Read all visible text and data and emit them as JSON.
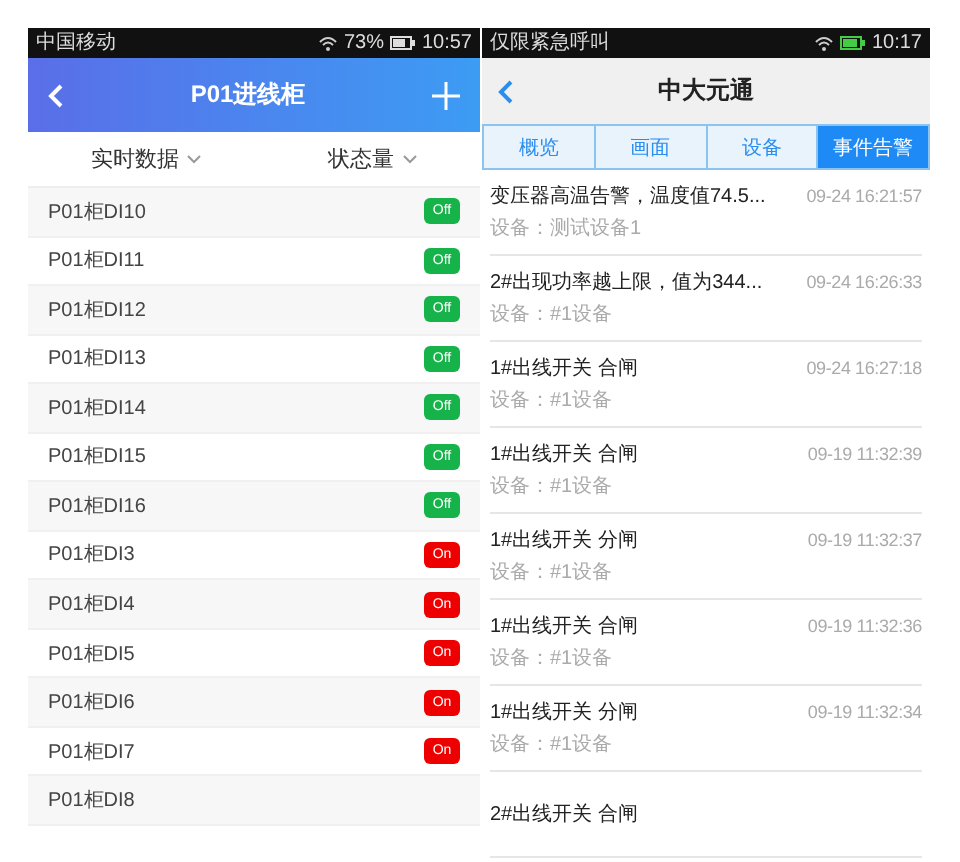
{
  "left_screen": {
    "status_bar": {
      "carrier": "中国移动",
      "battery": "73%",
      "time": "10:57"
    },
    "header": {
      "title": "P01进线柜"
    },
    "filters": [
      "实时数据",
      "状态量"
    ],
    "rows": [
      {
        "name": "P01柜DI10",
        "state": "Off",
        "on": false
      },
      {
        "name": "P01柜DI11",
        "state": "Off",
        "on": false
      },
      {
        "name": "P01柜DI12",
        "state": "Off",
        "on": false
      },
      {
        "name": "P01柜DI13",
        "state": "Off",
        "on": false
      },
      {
        "name": "P01柜DI14",
        "state": "Off",
        "on": false
      },
      {
        "name": "P01柜DI15",
        "state": "Off",
        "on": false
      },
      {
        "name": "P01柜DI16",
        "state": "Off",
        "on": false
      },
      {
        "name": "P01柜DI3",
        "state": "On",
        "on": true
      },
      {
        "name": "P01柜DI4",
        "state": "On",
        "on": true
      },
      {
        "name": "P01柜DI5",
        "state": "On",
        "on": true
      },
      {
        "name": "P01柜DI6",
        "state": "On",
        "on": true
      },
      {
        "name": "P01柜DI7",
        "state": "On",
        "on": true
      },
      {
        "name": "P01柜DI8"
      }
    ]
  },
  "right_screen": {
    "status_bar": {
      "carrier": "仅限紧急呼叫",
      "time": "10:17"
    },
    "header": {
      "title": "中大元通"
    },
    "tabs": [
      {
        "label": "概览",
        "selected": false
      },
      {
        "label": "画面",
        "selected": false
      },
      {
        "label": "设备",
        "selected": false
      },
      {
        "label": "事件告警",
        "selected": true
      }
    ],
    "events": [
      {
        "title": "变压器高温告警，温度值74.5...",
        "device": "设备：测试设备1",
        "time": "09-24 16:21:57"
      },
      {
        "title": "2#出现功率越上限，值为344...",
        "device": "设备：#1设备",
        "time": "09-24 16:26:33"
      },
      {
        "title": "1#出线开关 合闸",
        "device": "设备：#1设备",
        "time": "09-24 16:27:18"
      },
      {
        "title": "1#出线开关 合闸",
        "device": "设备：#1设备",
        "time": "09-19 11:32:39"
      },
      {
        "title": "1#出线开关 分闸",
        "device": "设备：#1设备",
        "time": "09-19 11:32:37"
      },
      {
        "title": "1#出线开关 合闸",
        "device": "设备：#1设备",
        "time": "09-19 11:32:36"
      },
      {
        "title": "1#出线开关 分闸",
        "device": "设备：#1设备",
        "time": "09-19 11:32:34"
      },
      {
        "title": "2#出线开关 合闸"
      }
    ]
  }
}
